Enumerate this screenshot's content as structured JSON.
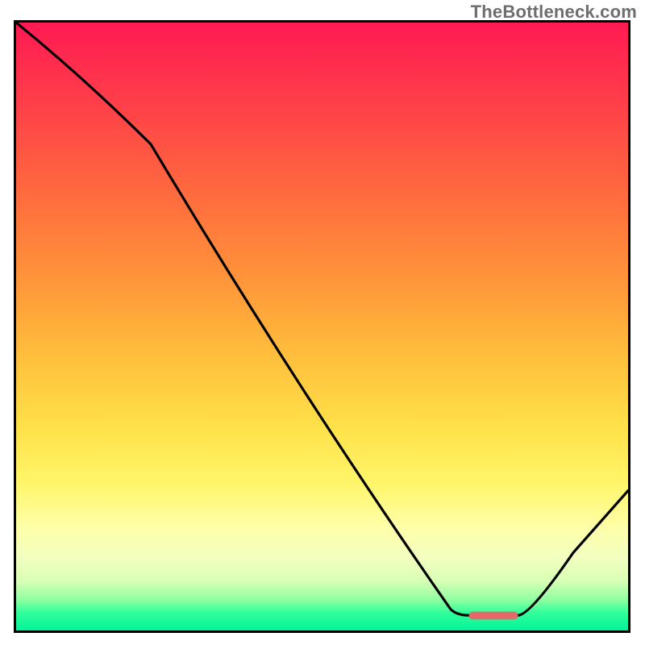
{
  "watermark": "TheBottleneck.com",
  "chart_data": {
    "type": "line",
    "title": "",
    "xlabel": "",
    "ylabel": "",
    "xlim": [
      0,
      100
    ],
    "ylim": [
      0,
      100
    ],
    "grid": false,
    "series": [
      {
        "name": "bottleneck-curve",
        "x": [
          0,
          22,
          71,
          74,
          82,
          100
        ],
        "values": [
          100,
          80,
          3.5,
          2.5,
          2.5,
          23
        ],
        "color": "#000000"
      }
    ],
    "marker": {
      "name": "optimal-range",
      "x_start": 74,
      "x_end": 82,
      "y": 2.5,
      "color": "#e46a6a"
    },
    "background": {
      "type": "vertical-gradient",
      "stops": [
        {
          "pos": 0,
          "color": "#ff1a52"
        },
        {
          "pos": 50,
          "color": "#ffb93c"
        },
        {
          "pos": 80,
          "color": "#fffb8a"
        },
        {
          "pos": 100,
          "color": "#00f39a"
        }
      ]
    }
  }
}
